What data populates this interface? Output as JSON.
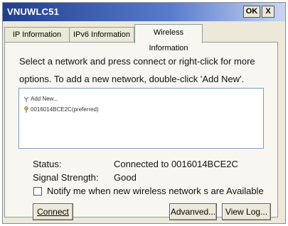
{
  "window": {
    "title": "VNUWLC51",
    "ok_label": "OK",
    "close_label": "X"
  },
  "tabs": [
    {
      "label": "IP Information"
    },
    {
      "label": "IPv6 Information"
    },
    {
      "label": "Wireless Information",
      "active": true
    }
  ],
  "instructions": {
    "line1": "Select a network and press connect or right-click for more",
    "line2": "options. To add a new network, double-click 'Add New'."
  },
  "networks": [
    {
      "label": "Add New...",
      "icon": "antenna-icon"
    },
    {
      "label": "0016014BCE2C(preferred)",
      "icon": "network-pin-icon"
    }
  ],
  "status": {
    "status_label": "Status:",
    "status_value": "Connected to 0016014BCE2C",
    "signal_label": "Signal Strength:",
    "signal_value": "Good"
  },
  "notify": {
    "label": "Notify me when new wireless network s are Available",
    "checked": false
  },
  "buttons": {
    "connect": "Connect",
    "advanced": "Advanved...",
    "view_log": "View Log..."
  }
}
